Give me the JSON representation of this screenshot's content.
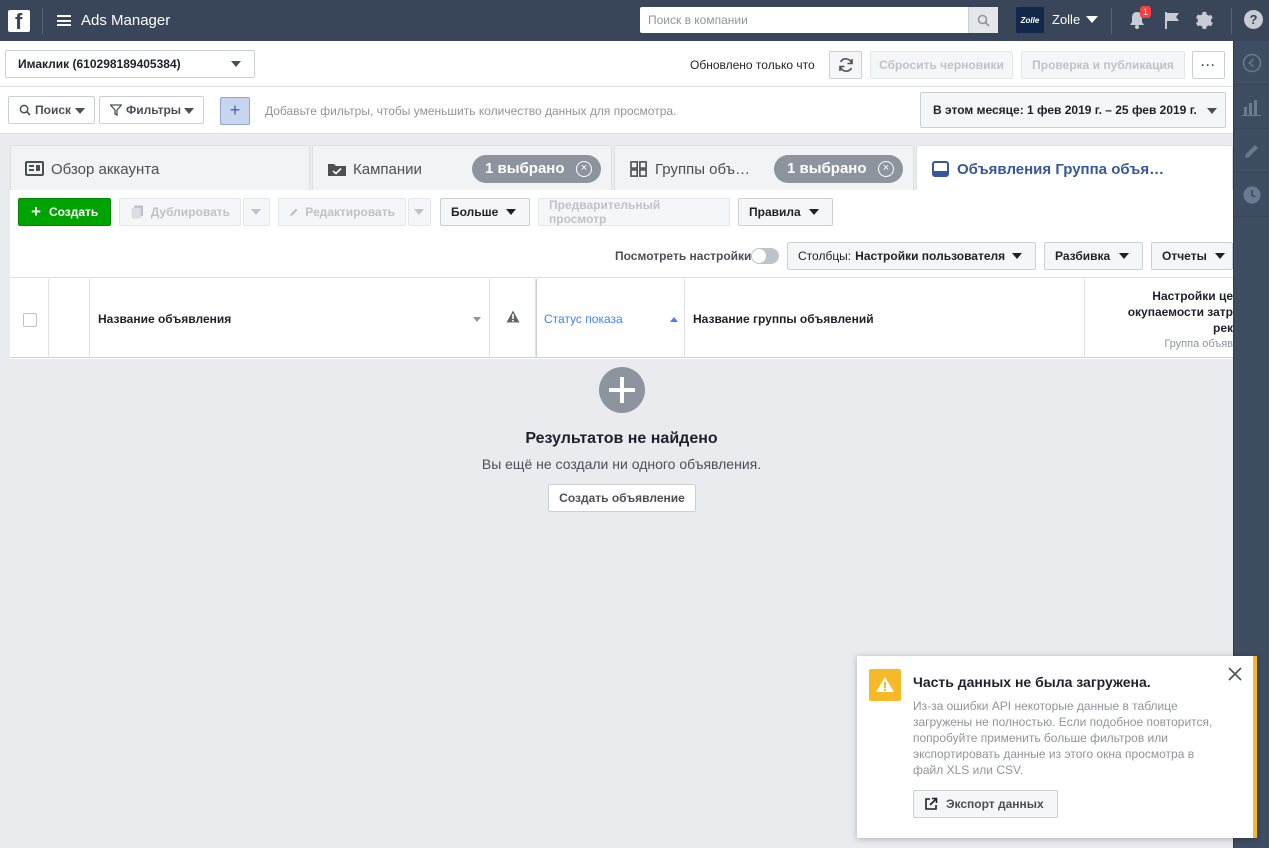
{
  "topbar": {
    "app_title": "Ads Manager",
    "search_placeholder": "Поиск в компании",
    "account_badge": "Zolle",
    "user_name": "Zolle",
    "notification_count": "1"
  },
  "account_bar": {
    "account_name": "Имаклик (610298189405384)",
    "updated_text": "Обновлено только что",
    "discard_drafts": "Сбросить черновики",
    "review_publish": "Проверка и публикация",
    "more": "···"
  },
  "filter_bar": {
    "search": "Поиск",
    "filters": "Фильтры",
    "hint": "Добавьте фильтры, чтобы уменьшить количество данных для просмотра.",
    "date_range": "В этом месяце: 1 фев 2019 г. – 25 фев 2019 г."
  },
  "tabs": [
    {
      "label": "Обзор аккаунта"
    },
    {
      "label": "Кампании",
      "chip": "1 выбрано"
    },
    {
      "label": "Группы объ…",
      "chip": "1 выбрано"
    },
    {
      "label": "Объявления Группа объя…"
    }
  ],
  "toolbar": {
    "create": "Создать",
    "duplicate": "Дублировать",
    "edit": "Редактировать",
    "more": "Больше",
    "preview": "Предварительный просмотр",
    "rules": "Правила",
    "view_settings": "Посмотреть настройки",
    "columns_prefix": "Столбцы:",
    "columns_value": "Настройки пользователя",
    "breakdown": "Разбивка",
    "reports": "Отчеты"
  },
  "table": {
    "col_ad_name": "Название объявления",
    "col_delivery": "Статус показа",
    "col_adset_name": "Название группы объявлений",
    "col_bid_line1": "Настройки це",
    "col_bid_line2": "окупаемости затр",
    "col_bid_line3": "рек",
    "col_bid_sub": "Группа объяв"
  },
  "empty_state": {
    "title": "Результатов не найдено",
    "subtitle": "Вы ещё не создали ни одного объявления.",
    "button": "Создать объявление"
  },
  "toast": {
    "title": "Часть данных не была загружена.",
    "text": "Из-за ошибки API некоторые данные в таблице загружены не полностью. Если подобное повторится, попробуйте применить больше фильтров или экспортировать данные из этого окна просмотра в файл XLS или CSV.",
    "button": "Экспорт данных"
  },
  "colors": {
    "topbar": "#394559",
    "create_green": "#00a400",
    "link_blue": "#4080ff",
    "warning": "#f7b928"
  }
}
